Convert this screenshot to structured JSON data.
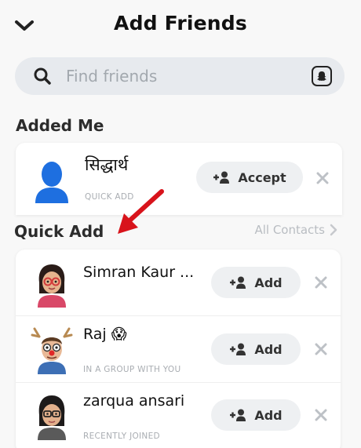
{
  "header": {
    "title": "Add Friends"
  },
  "search": {
    "placeholder": "Find friends"
  },
  "added_me": {
    "section_title": "Added Me",
    "items": [
      {
        "name": "सिद्धार्थ",
        "sub": "QUICK ADD",
        "action_label": "Accept"
      }
    ]
  },
  "quick_add": {
    "section_title": "Quick Add",
    "all_contacts_label": "All Contacts",
    "items": [
      {
        "name": "Simran Kaur ...",
        "sub": "",
        "action_label": "Add"
      },
      {
        "name": "Raj 😱",
        "sub": "IN A GROUP WITH YOU",
        "action_label": "Add"
      },
      {
        "name": "zarqua ansari",
        "sub": "RECENTLY JOINED",
        "action_label": "Add"
      }
    ]
  },
  "colors": {
    "accent_blue": "#1e6fe0",
    "arrow_red": "#d8131b",
    "pill_bg": "#eef0f2",
    "muted": "#a9adb2"
  },
  "icons": [
    "chevron-down-icon",
    "search-icon",
    "snapcode-icon",
    "add-friend-icon",
    "close-icon",
    "chevron-right-icon"
  ]
}
